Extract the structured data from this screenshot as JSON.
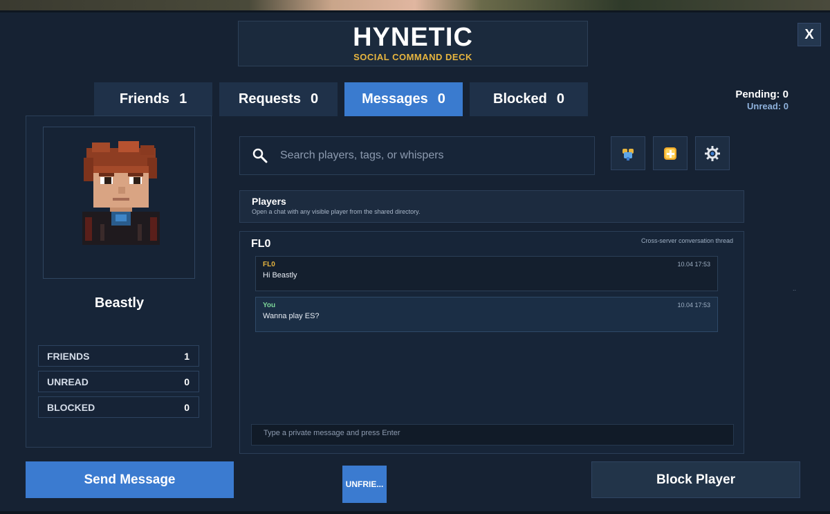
{
  "header": {
    "title": "HYNETIC",
    "subtitle": "SOCIAL COMMAND DECK",
    "close_label": "X"
  },
  "tabs": [
    {
      "label": "Friends",
      "count": "1"
    },
    {
      "label": "Requests",
      "count": "0"
    },
    {
      "label": "Messages",
      "count": "0",
      "active": true
    },
    {
      "label": "Blocked",
      "count": "0"
    }
  ],
  "status": {
    "pending": "Pending: 0",
    "unread": "Unread: 0"
  },
  "profile": {
    "name": "Beastly",
    "stats": [
      {
        "label": "FRIENDS",
        "value": "1"
      },
      {
        "label": "UNREAD",
        "value": "0"
      },
      {
        "label": "BLOCKED",
        "value": "0"
      }
    ]
  },
  "search": {
    "placeholder": "Search players, tags, or whispers",
    "icon": "search-icon"
  },
  "toolbar_icons": [
    "party-icon",
    "add-friend-icon",
    "settings-gear-icon"
  ],
  "players": {
    "title": "Players",
    "subtitle": "Open a chat with any visible player from the shared directory."
  },
  "chat": {
    "partner": "FL0",
    "thread_label": "Cross-server conversation thread",
    "messages": [
      {
        "author": "FL0",
        "time": "10.04 17:53",
        "text": "Hi Beastly",
        "mine": false
      },
      {
        "author": "You",
        "time": "10.04 17:53",
        "text": "Wanna play ES?",
        "mine": true
      }
    ],
    "input_placeholder": "Type a private message and press Enter"
  },
  "actions": {
    "send": "Send Message",
    "unfriend": "UNFRIE...",
    "block": "Block Player"
  },
  "colors": {
    "background": "#162233",
    "accent": "#3a7bcf",
    "gold": "#e7b53f",
    "self_author": "#7ed89a"
  }
}
